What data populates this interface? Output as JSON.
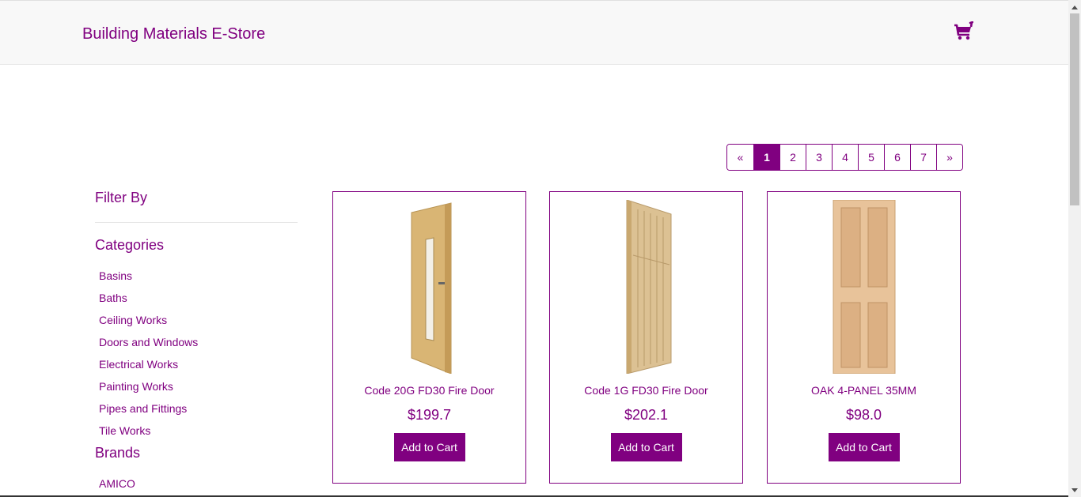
{
  "navbar": {
    "brand": "Building Materials E-Store",
    "cart_icon": "shopping-cart-icon",
    "accent": "#800080"
  },
  "pagination": {
    "prev": "«",
    "pages": [
      "1",
      "2",
      "3",
      "4",
      "5",
      "6",
      "7"
    ],
    "next": "»",
    "active": "1"
  },
  "sidebar": {
    "filter_title": "Filter By",
    "categories_title": "Categories",
    "categories": [
      "Basins",
      "Baths",
      "Ceiling Works",
      "Doors and Windows",
      "Electrical Works",
      "Painting Works",
      "Pipes and Fittings",
      "Tile Works"
    ],
    "brands_title": "Brands",
    "brands": [
      "AMICO"
    ]
  },
  "products": [
    {
      "name": "Code 20G FD30 Fire Door",
      "price": "$199.7",
      "button": "Add to Cart"
    },
    {
      "name": "Code 1G FD30 Fire Door",
      "price": "$202.1",
      "button": "Add to Cart"
    },
    {
      "name": "OAK 4-PANEL 35MM",
      "price": "$98.0",
      "button": "Add to Cart"
    }
  ]
}
